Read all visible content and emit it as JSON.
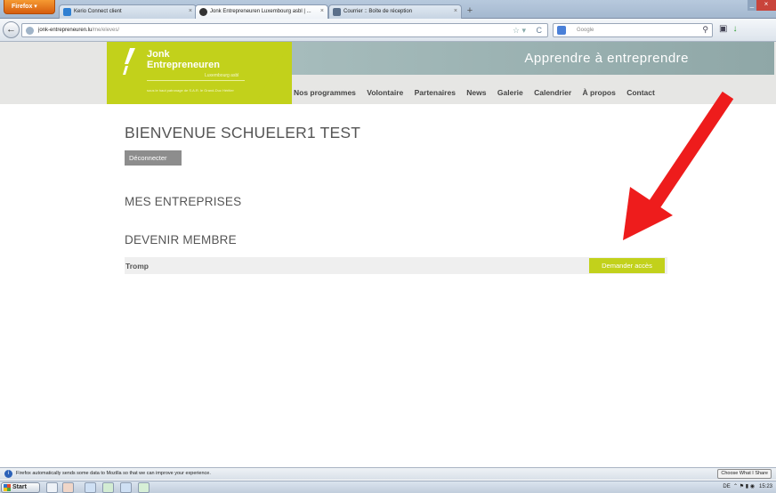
{
  "browser": {
    "firefox_button": "Firefox ▾",
    "tabs": [
      {
        "label": "Kerio Connect client",
        "icon_color": "#2f7fd1"
      },
      {
        "label": "Jonk Entrepreneuren Luxembourg asbl | ...",
        "icon_color": "#333333"
      },
      {
        "label": "Courrier :: Boîte de réception",
        "icon_color": "#5a6f8a"
      }
    ],
    "url_domain": "jonk-entrepreneuren.lu",
    "url_path": "/me/eleves/",
    "search_placeholder": "Google"
  },
  "site": {
    "logo_line1": "Jonk",
    "logo_line2": "Entrepreneuren",
    "logo_sub": "Luxembourg asbl",
    "logo_tagline": "sous le haut patronage de S.A.R. le Grand-Duc Héritier",
    "tagline": "Apprendre à entreprendre",
    "nav": [
      "Nos programmes",
      "Volontaire",
      "Partenaires",
      "News",
      "Galerie",
      "Calendrier",
      "À propos",
      "Contact"
    ],
    "accent_color": "#c2d11b"
  },
  "page": {
    "welcome": "BIENVENUE SCHUELER1 TEST",
    "logout_label": "Déconnecter",
    "section_entreprises": "MES ENTREPRISES",
    "section_membre": "DEVENIR MEMBRE",
    "company_name": "Tromp",
    "request_label": "Demander accès"
  },
  "notification": {
    "text": "Firefox automatically sends some data to Mozilla so that we can improve your experience.",
    "button": "Choose What I Share"
  },
  "taskbar": {
    "start_label": "Start",
    "language": "DE",
    "time": "15:23"
  }
}
